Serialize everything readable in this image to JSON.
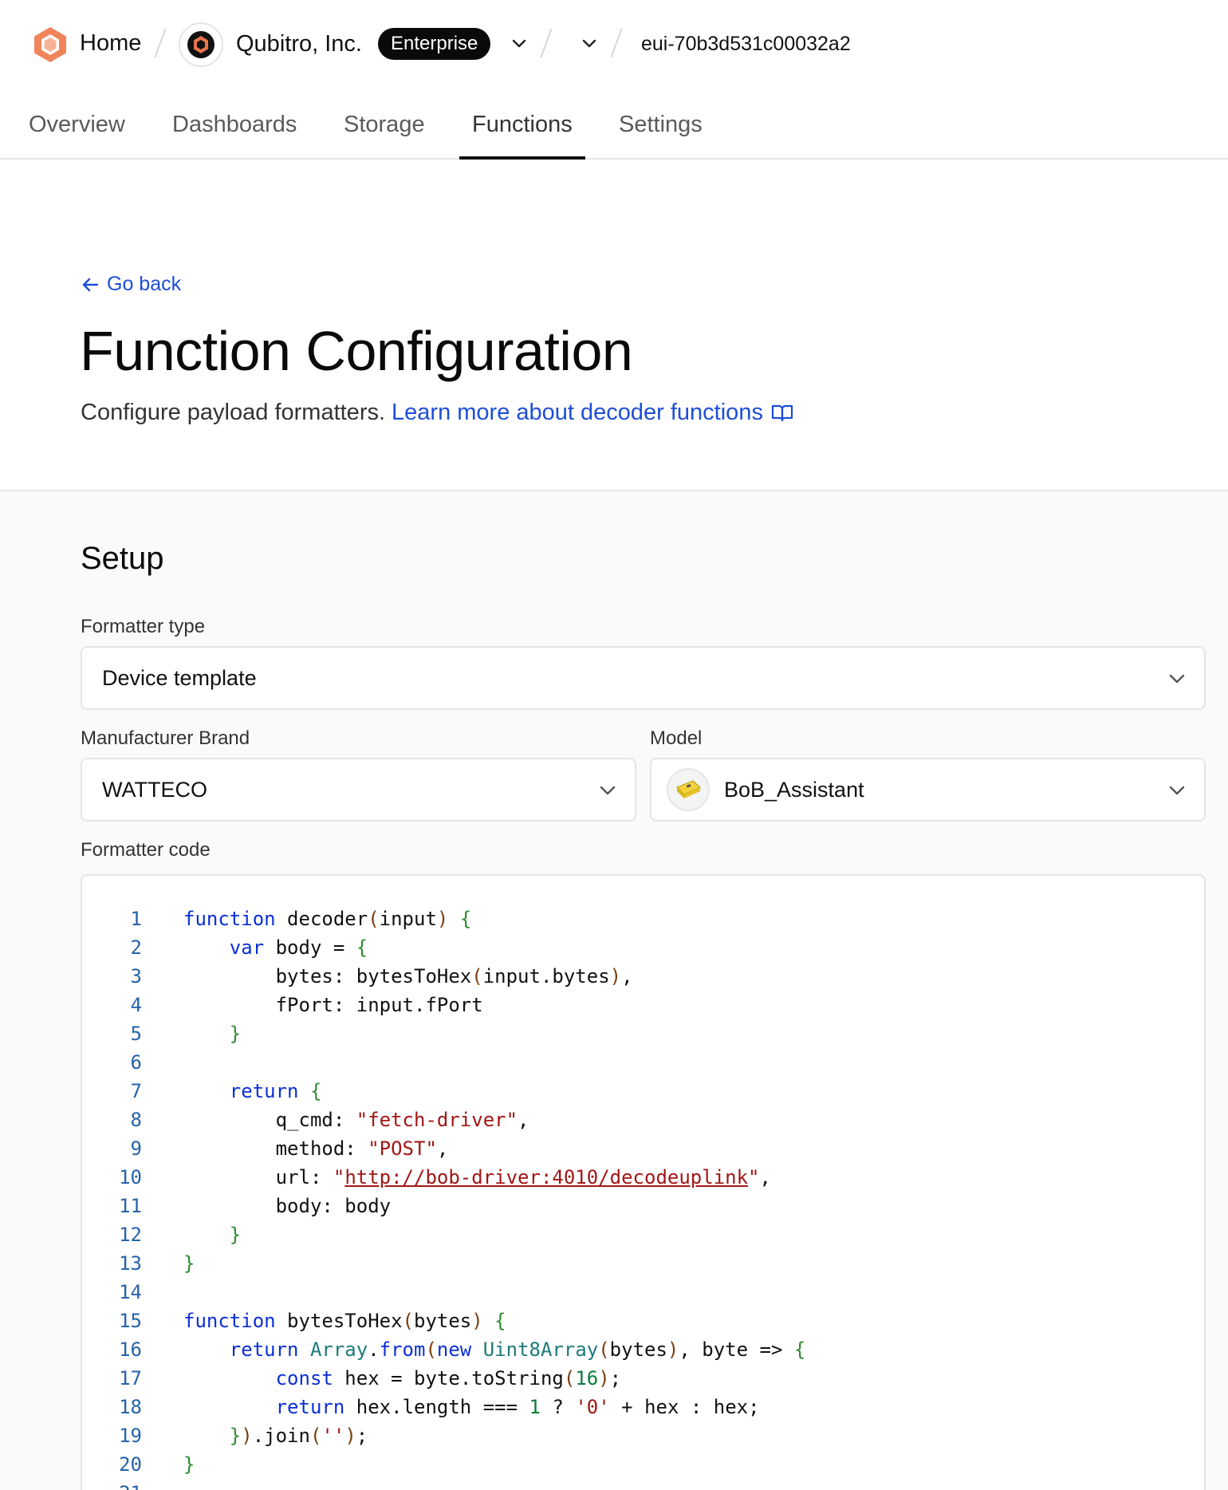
{
  "topbar": {
    "home_label": "Home",
    "org_name": "Qubitro, Inc.",
    "plan_badge": "Enterprise",
    "device_id": "eui-70b3d531c00032a2"
  },
  "tabs": [
    {
      "label": "Overview",
      "active": false
    },
    {
      "label": "Dashboards",
      "active": false
    },
    {
      "label": "Storage",
      "active": false
    },
    {
      "label": "Functions",
      "active": true
    },
    {
      "label": "Settings",
      "active": false
    }
  ],
  "header": {
    "go_back": "Go back",
    "title": "Function Configuration",
    "subtitle": "Configure payload formatters.",
    "learn_more": "Learn more about decoder functions"
  },
  "setup": {
    "title": "Setup",
    "formatter_type_label": "Formatter type",
    "formatter_type_value": "Device template",
    "manufacturer_label": "Manufacturer Brand",
    "manufacturer_value": "WATTECO",
    "model_label": "Model",
    "model_value": "BoB_Assistant",
    "code_label": "Formatter code"
  },
  "code_lines": [
    "function decoder(input) {",
    "    var body = {",
    "        bytes: bytesToHex(input.bytes),",
    "        fPort: input.fPort",
    "    }",
    "",
    "    return {",
    "        q_cmd: \"fetch-driver\",",
    "        method: \"POST\",",
    "        url: \"http://bob-driver:4010/decodeuplink\",",
    "        body: body",
    "    }",
    "}",
    "",
    "function bytesToHex(bytes) {",
    "    return Array.from(new Uint8Array(bytes), byte => {",
    "        const hex = byte.toString(16);",
    "        return hex.length === 1 ? '0' + hex : hex;",
    "    }).join('');",
    "}",
    ""
  ],
  "colors": {
    "link": "#1d4ed8",
    "keyword": "#0b2fd6",
    "string": "#a31515",
    "number": "#0b7a3b",
    "brand_orange": "#f0845a"
  },
  "icons": {
    "logo": "hexagon-logo-icon",
    "back": "arrow-left-icon",
    "docs": "book-open-icon",
    "dropdown": "chevron-down-icon"
  }
}
